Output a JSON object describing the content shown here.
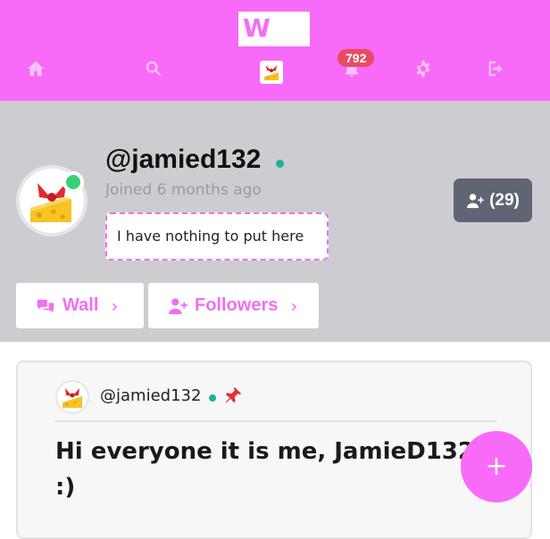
{
  "nav": {
    "logo_text": "W",
    "notification_count": "792",
    "items": [
      {
        "name": "home-icon"
      },
      {
        "name": "search-icon"
      },
      {
        "name": "profile-avatar"
      },
      {
        "name": "bell-icon"
      },
      {
        "name": "gear-icon"
      },
      {
        "name": "logout-icon"
      }
    ],
    "accent": "#f86bf8"
  },
  "profile": {
    "username": "@jamied132",
    "joined": "Joined 6 months ago",
    "bio": "I have nothing to put here",
    "friend_count": "(29)",
    "online_color": "#3ad07a"
  },
  "tabs": [
    {
      "label": "Wall",
      "chevron": "›"
    },
    {
      "label": "Followers",
      "chevron": "›"
    }
  ],
  "post": {
    "username": "@jamied132",
    "pinned": true,
    "text": "Hi everyone it is me, JamieD132 :)"
  },
  "fab": {
    "label": "+"
  }
}
